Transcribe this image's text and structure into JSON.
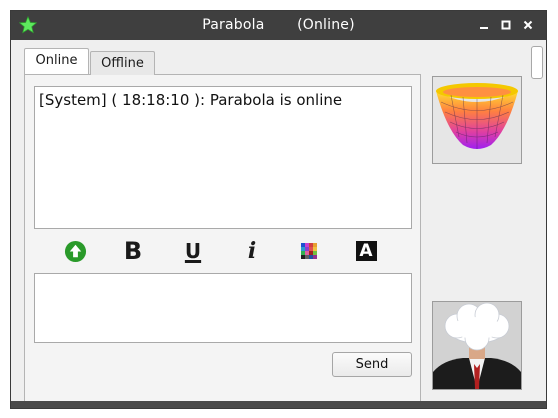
{
  "window": {
    "title": "Parabola",
    "status": "(Online)",
    "accent": "#3f3f3f",
    "app_icon": "star-icon",
    "controls": [
      "minimize-icon",
      "maximize-icon",
      "close-icon"
    ]
  },
  "tabs": [
    {
      "label": "Online",
      "selected": true
    },
    {
      "label": "Offline",
      "selected": false
    }
  ],
  "chat": {
    "messages": [
      {
        "text": "[System] ( 18:18:10 ): Parabola is online"
      }
    ]
  },
  "toolbar": {
    "upload_icon": "upload-arrow-icon",
    "bold_glyph": "B",
    "underline_glyph": "U",
    "italic_glyph": "i",
    "color_icon": "color-palette-icon",
    "font_glyph": "A"
  },
  "input": {
    "value": ""
  },
  "send_label": "Send",
  "avatars": {
    "peer": "parabola-surface-image",
    "self": "person-with-cloud-image"
  }
}
